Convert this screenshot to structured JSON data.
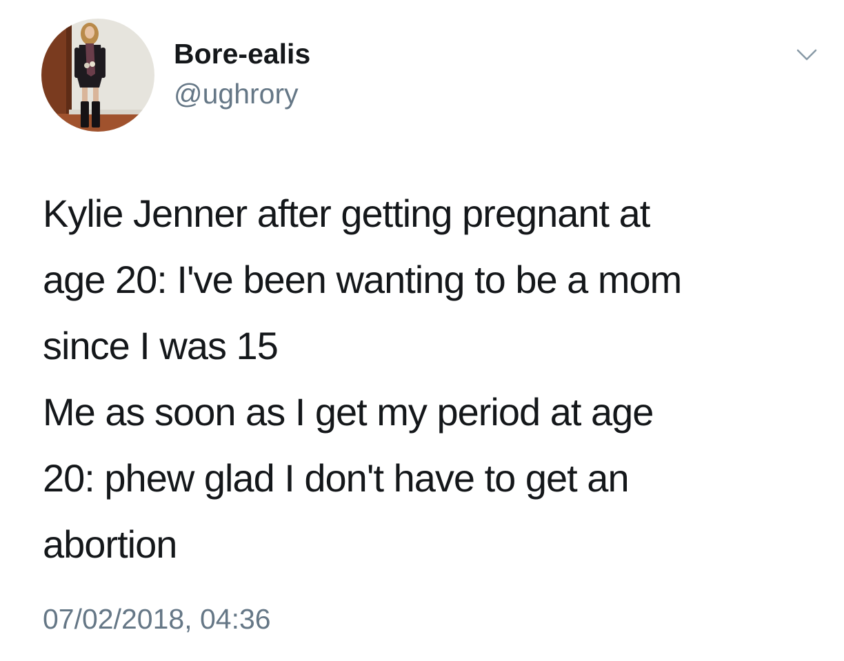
{
  "user": {
    "display_name": "Bore-ealis",
    "handle": "@ughrory",
    "avatar_icon": "profile-photo"
  },
  "menu": {
    "icon": "chevron-down-icon"
  },
  "tweet": {
    "lines": [
      "Kylie Jenner after getting pregnant at",
      "age 20: I've been wanting to be a mom",
      "since I was 15",
      "Me as soon as I get my period at age",
      "20: phew glad I don't have to get an",
      "abortion"
    ],
    "timestamp": "07/02/2018, 04:36"
  },
  "colors": {
    "text_primary": "#14171a",
    "text_secondary": "#657786",
    "caret": "#8899a6",
    "background": "#ffffff"
  }
}
